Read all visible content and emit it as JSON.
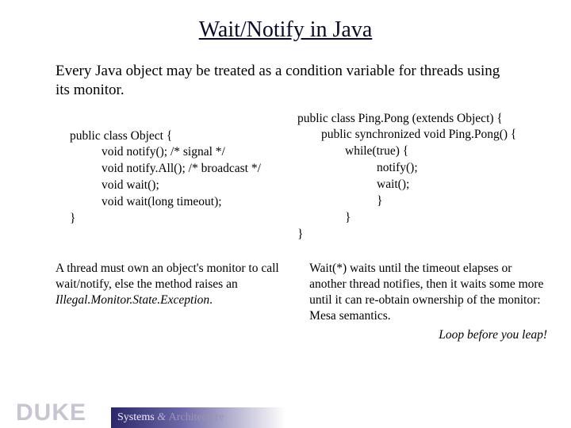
{
  "title": "Wait/Notify in Java",
  "intro": "Every Java object may be treated as a condition variable for threads using its monitor.",
  "code_left": {
    "l1": "public class Object {",
    "l2": "void notify();      /* signal */",
    "l3": "void notify.All(); /* broadcast */",
    "l4": "void wait();",
    "l5": "void wait(long timeout);",
    "l6": "}"
  },
  "code_right": {
    "r1": "public class Ping.Pong (extends Object) {",
    "r2": "public synchronized void Ping.Pong() {",
    "r3": "while(true) {",
    "r4": "notify();",
    "r5": "wait();",
    "r6": "}",
    "r7": "}",
    "r8": "}"
  },
  "note_left": {
    "part1": "A thread must own an object's monitor to call wait/notify, else the method raises an ",
    "exc": "Illegal.Monitor.State.Exception",
    "part2": "."
  },
  "note_right": {
    "body": "Wait(*) waits until the timeout elapses or another thread notifies, then it waits some more until it can re-obtain ownership of the monitor: Mesa semantics.",
    "loop": "Loop before you leap!"
  },
  "footer": {
    "duke": "DUKE",
    "systems": "Systems",
    "amp": " & ",
    "arch": "Architecture"
  }
}
